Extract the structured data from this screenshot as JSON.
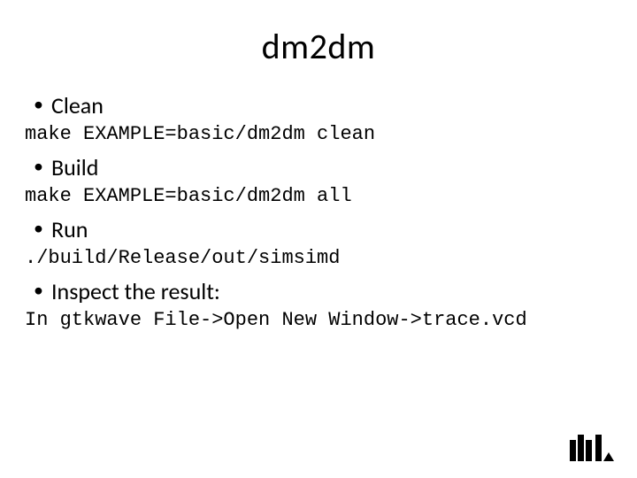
{
  "title": "dm2dm",
  "items": [
    {
      "label": "Clean",
      "code": "make EXAMPLE=basic/dm2dm clean"
    },
    {
      "label": "Build",
      "code": "make EXAMPLE=basic/dm2dm all"
    },
    {
      "label": "Run",
      "code": "./build/Release/out/simsimd"
    },
    {
      "label": "Inspect the result:",
      "code": "In gtkwave File->Open New Window->trace.vcd"
    }
  ]
}
